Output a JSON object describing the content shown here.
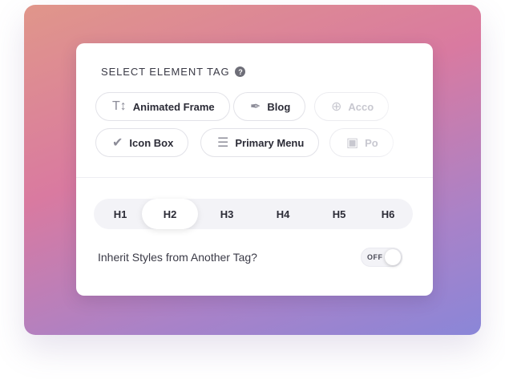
{
  "panel": {
    "heading": "SELECT ELEMENT TAG",
    "help_icon": "?",
    "chips_row1": [
      {
        "icon": "text-size-icon",
        "glyph": "T↕",
        "label": "Animated Frame"
      },
      {
        "icon": "feather-icon",
        "glyph": "✒",
        "label": "Blog"
      },
      {
        "icon": "plus-circle-icon",
        "glyph": "⊕",
        "label": "Acco"
      }
    ],
    "chips_row2": [
      {
        "icon": "check-circle-icon",
        "glyph": "✔",
        "label": "Icon Box"
      },
      {
        "icon": "list-icon",
        "glyph": "☰",
        "label": "Primary Menu"
      },
      {
        "icon": "camera-icon",
        "glyph": "▣",
        "label": "Po"
      }
    ],
    "heading_tabs": [
      "H1",
      "H2",
      "H3",
      "H4",
      "H5",
      "H6"
    ],
    "active_heading_tab": "H2",
    "inherit_label": "Inherit Styles from Another Tag?",
    "toggle_label": "OFF",
    "toggle_on": false
  }
}
